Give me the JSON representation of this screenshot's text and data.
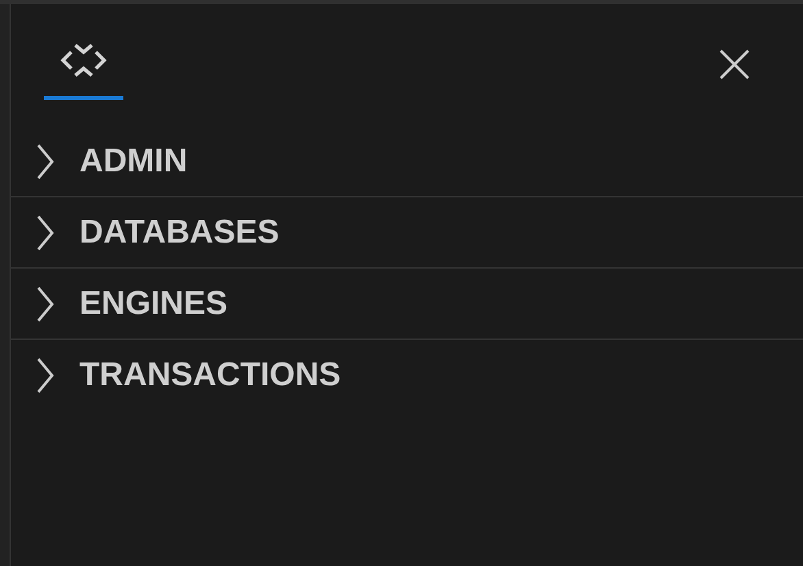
{
  "tabs": [
    {
      "kind": "logo",
      "selected": true
    }
  ],
  "sections": [
    {
      "label": "ADMIN",
      "expanded": false
    },
    {
      "label": "DATABASES",
      "expanded": false
    },
    {
      "label": "ENGINES",
      "expanded": false
    },
    {
      "label": "TRANSACTIONS",
      "expanded": false
    }
  ]
}
